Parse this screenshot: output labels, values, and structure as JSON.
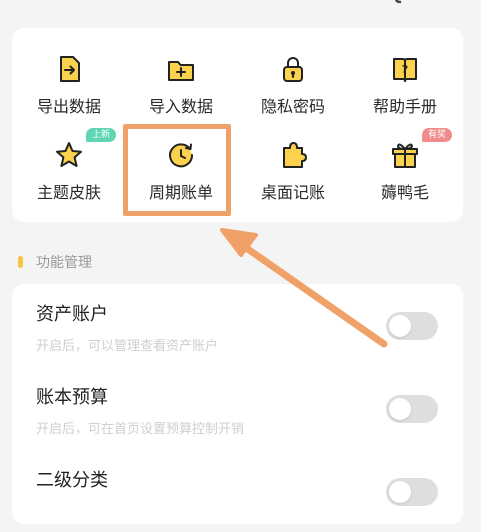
{
  "grid": [
    {
      "label": "导出数据",
      "icon": "export-data-icon",
      "badge": null
    },
    {
      "label": "导入数据",
      "icon": "import-data-icon",
      "badge": null
    },
    {
      "label": "隐私密码",
      "icon": "privacy-lock-icon",
      "badge": null
    },
    {
      "label": "帮助手册",
      "icon": "help-manual-icon",
      "badge": null
    },
    {
      "label": "主题皮肤",
      "icon": "theme-star-icon",
      "badge": "上新",
      "badge_color": "#5ed6b3"
    },
    {
      "label": "周期账单",
      "icon": "periodic-bill-icon",
      "badge": null
    },
    {
      "label": "桌面记账",
      "icon": "desktop-widget-icon",
      "badge": null
    },
    {
      "label": "薅鸭毛",
      "icon": "gift-icon",
      "badge": "有奖",
      "badge_color": "#f08c8c"
    }
  ],
  "section": {
    "title": "功能管理"
  },
  "settings": [
    {
      "title": "资产账户",
      "subtitle": "开启后，可以管理查看资产账户",
      "enabled": false
    },
    {
      "title": "账本预算",
      "subtitle": "开启后，可在首页设置预算控制开销",
      "enabled": false
    },
    {
      "title": "二级分类",
      "subtitle": "",
      "enabled": false
    }
  ],
  "colors": {
    "accent_yellow": "#f6c445",
    "highlight_orange": "#f0a168",
    "toggle_off": "#dedede"
  }
}
